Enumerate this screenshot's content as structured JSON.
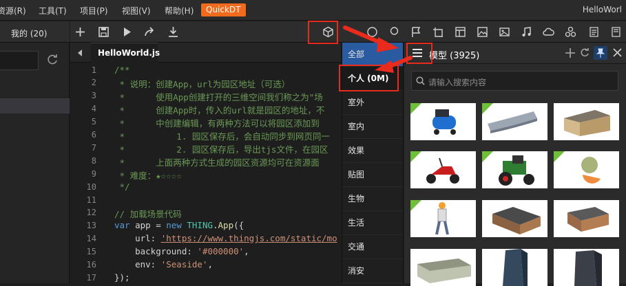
{
  "menubar": {
    "items": [
      "资源(R)",
      "工具(T)",
      "项目(P)",
      "视图(V)",
      "帮助(H)"
    ],
    "quickdt": "QuickDT",
    "app_title": "HelloWorl"
  },
  "left_panel": {
    "tab_label": "我的 (20)"
  },
  "editor": {
    "tab_label": "HelloWorld.js",
    "line_numbers": [
      "1",
      "2",
      "3",
      "4",
      "5",
      "6",
      "7",
      "8",
      "9",
      "10",
      "11",
      "12",
      "13",
      "14",
      "15",
      "16",
      "17"
    ],
    "lines": {
      "l1": "/**",
      "l2": " * 说明：创建App，url为园区地址（可选）",
      "l3": " *      使用App创建打开的三维空间我们称之为\"场",
      "l4": " *      创建App时，传入的url就是园区的地址，不",
      "l5": " *      中创建编辑，有两种方法可以将园区添加到",
      "l6": " *          1. 园区保存后，会自动同步到网页同一",
      "l7": " *          2. 园区保存后，导出tjs文件，在园区",
      "l8": " *      上面两种方式生成的园区资源均可在资源面",
      "l9": " * 难度：★☆☆☆☆",
      "l10": " */",
      "l11": "",
      "l12": "// 加载场景代码",
      "l13_kw": "var",
      "l13_a": " app = ",
      "l13_new": "new",
      "l13_cls": " THING",
      "l13_b": ".",
      "l13_fn": "App",
      "l13_c": "({",
      "l14_key": "    url: ",
      "l14_val": "'https://www.thingjs.com/static/mo",
      "l15_key": "    background: ",
      "l15_val": "'#000000'",
      "l15_end": ",",
      "l16_key": "    env: ",
      "l16_val": "'Seaside'",
      "l16_end": ",",
      "l17": "});"
    }
  },
  "category_menu": {
    "items": [
      "全部",
      "个人 (0M)",
      "室外",
      "室内",
      "效果",
      "贴图",
      "生物",
      "生活",
      "交通",
      "消安"
    ]
  },
  "model_panel": {
    "title": "模型  (3925)",
    "search_placeholder": "请输入搜索内容",
    "thumbnails": [
      "air-compressor",
      "curved-building",
      "tan-building",
      "scooter",
      "tractor",
      "melon",
      "worker",
      "brick-building",
      "brick-building-2",
      "office-block",
      "glass-tower",
      "dark-tower"
    ]
  },
  "colors": {
    "accent_orange": "#f26b1d",
    "selection_blue": "#2a5aa0",
    "annotation_red": "#e82b1c",
    "badge_green": "#6fbf3b"
  }
}
